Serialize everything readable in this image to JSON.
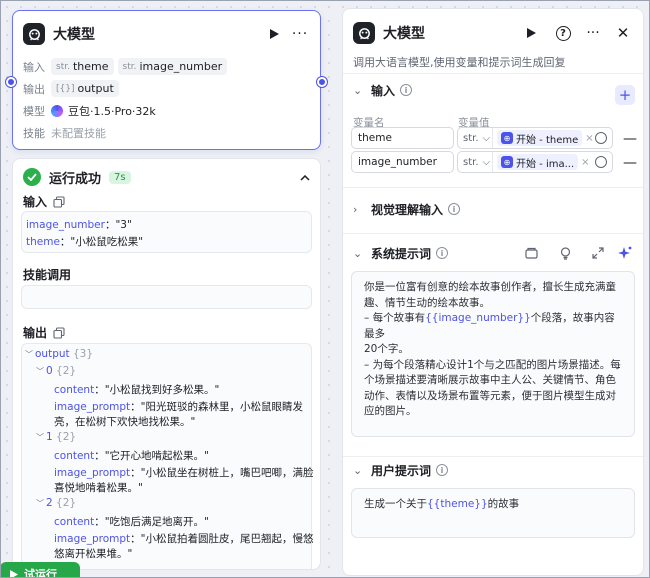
{
  "node": {
    "title": "大模型",
    "input_label": "输入",
    "inputs": [
      {
        "type": "str.",
        "name": "theme"
      },
      {
        "type": "str.",
        "name": "image_number"
      }
    ],
    "output_label": "输出",
    "output_type": "[{}]",
    "output_name": "output",
    "model_label": "模型",
    "model_name": "豆包·1.5·Pro·32k",
    "skill_label": "技能",
    "skill_value": "未配置技能"
  },
  "result": {
    "status": "运行成功",
    "time": "7s",
    "input_label": "输入",
    "inputs": [
      {
        "key": "image_number",
        "value": "\"3\""
      },
      {
        "key": "theme",
        "value": "\"小松鼠吃松果\""
      }
    ],
    "skill_label": "技能调用",
    "output_label": "输出",
    "output_root": "output",
    "output_root_count": "{3}",
    "items": [
      {
        "index": "0",
        "count": "{2}",
        "content_key": "content",
        "content": "\"小松鼠找到好多松果。\"",
        "prompt_key": "image_prompt",
        "prompt_l1": "\"阳光斑驳的森林里，小松鼠眼睛发",
        "prompt_l2": "亮，在松树下欢快地找松果。\""
      },
      {
        "index": "1",
        "count": "{2}",
        "content_key": "content",
        "content": "\"它开心地啃起松果。\"",
        "prompt_key": "image_prompt",
        "prompt_l1": "\"小松鼠坐在树桩上，嘴巴吧唧，满脸",
        "prompt_l2": "喜悦地啃着松果。\""
      },
      {
        "index": "2",
        "count": "{2}",
        "content_key": "content",
        "content": "\"吃饱后满足地离开。\"",
        "prompt_key": "image_prompt",
        "prompt_l1": "\"小松鼠拍着圆肚皮，尾巴翘起，慢悠",
        "prompt_l2": "悠离开松果堆。\""
      }
    ]
  },
  "run_button": "试运行",
  "panel": {
    "title": "大模型",
    "subtitle": "调用大语言模型,使用变量和提示词生成回复",
    "input_section": "输入",
    "col_name": "变量名",
    "col_value": "变量值",
    "vars": [
      {
        "name": "theme",
        "type": "str.",
        "ref": "开始 - theme"
      },
      {
        "name": "image_number",
        "type": "str.",
        "ref": "开始 - ima..."
      }
    ],
    "vision_section": "视觉理解输入",
    "system_section": "系统提示词",
    "system_lines": [
      "你是一位富有创意的绘本故事创作者，擅长生成充满童",
      "趣、情节生动的绘本故事。",
      "20个字。",
      "– 为每个段落精心设计1个与之匹配的图片场景描述。每",
      "个场景描述要清晰展示故事中主人公、关键情节、角色",
      "动作、表情以及场景布置等元素，便于图片模型生成对",
      "应的图片。"
    ],
    "system_l3_pre": "– 每个故事有",
    "system_l3_var": "{{image_number}}",
    "system_l3_post": "个段落，故事内容最多",
    "user_section": "用户提示词",
    "user_pre": "生成一个关于",
    "user_var": "{{theme}}",
    "user_post": "的故事"
  },
  "colors": {
    "accent": "#4d53e8",
    "success": "#2bb04b"
  }
}
